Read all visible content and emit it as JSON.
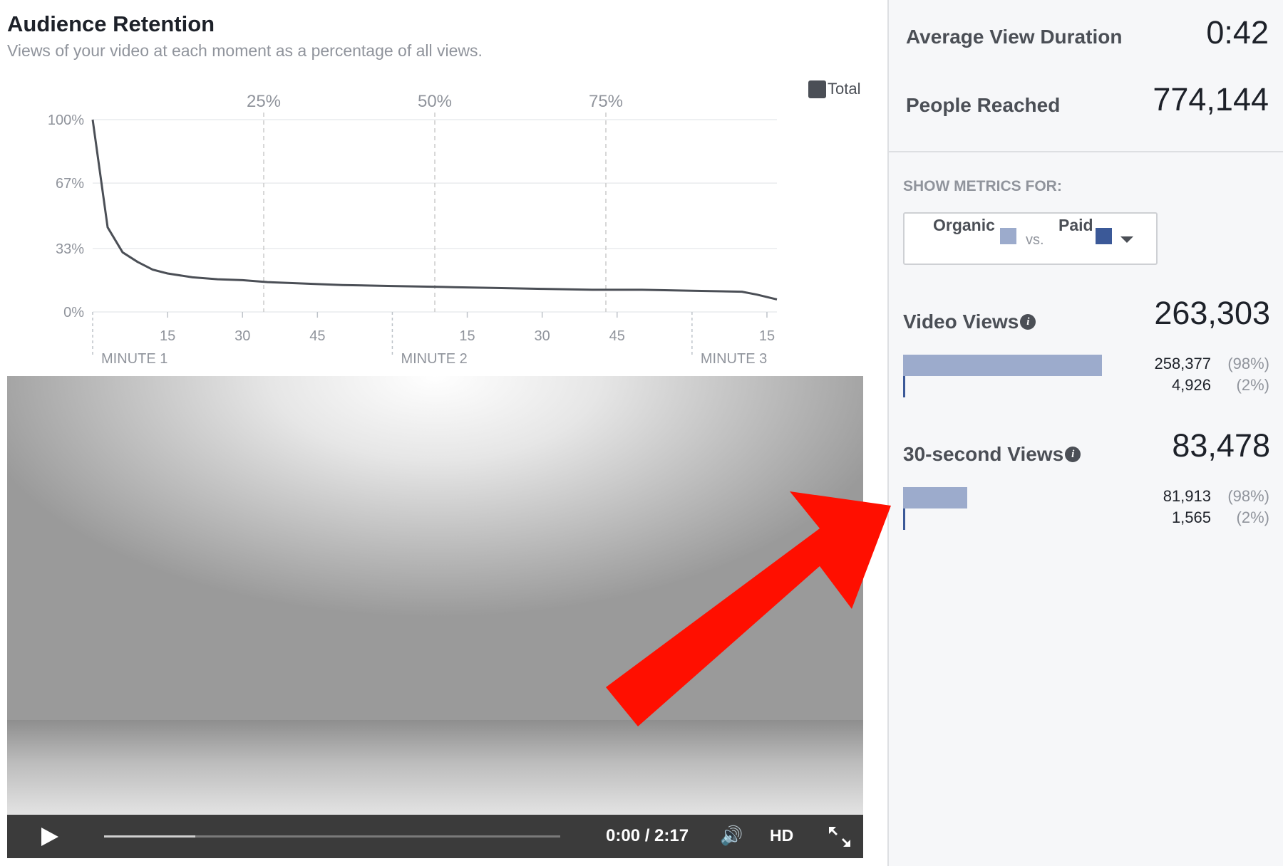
{
  "retention": {
    "title": "Audience Retention",
    "subtitle": "Views of your video at each moment as a percentage of all views.",
    "legend": "Total",
    "quartiles": [
      "25%",
      "50%",
      "75%"
    ],
    "y_ticks": [
      "100%",
      "67%",
      "33%",
      "0%"
    ],
    "x_ticks": [
      "15",
      "30",
      "45",
      "15",
      "30",
      "45",
      "15"
    ],
    "minute_labels": [
      "MINUTE 1",
      "MINUTE 2",
      "MINUTE 3"
    ]
  },
  "chart_data": {
    "type": "line",
    "title": "Audience Retention",
    "xlabel": "",
    "ylabel": "",
    "ylim": [
      0,
      100
    ],
    "xlim": [
      0,
      137
    ],
    "grid": true,
    "legend_position": "top-right",
    "series": [
      {
        "name": "Total",
        "color": "#4b4f56",
        "x": [
          0,
          3,
          6,
          9,
          12,
          15,
          20,
          25,
          30,
          35,
          40,
          45,
          50,
          60,
          70,
          80,
          90,
          100,
          110,
          120,
          130,
          133,
          137
        ],
        "y": [
          100,
          44,
          31,
          26,
          22,
          20,
          18,
          17,
          16.5,
          15.5,
          15,
          14.5,
          14,
          13.5,
          13,
          12.5,
          12,
          11.5,
          11.5,
          11,
          10.5,
          9,
          6.5
        ]
      }
    ],
    "quartile_markers": [
      "25%",
      "50%",
      "75%"
    ]
  },
  "video": {
    "time": "0:00 / 2:17",
    "hd_label": "HD",
    "progress": 0.2
  },
  "summary": {
    "avg_view_duration_label": "Average View Duration",
    "avg_view_duration_value": "0:42",
    "people_reached_label": "People Reached",
    "people_reached_value": "774,144"
  },
  "metrics": {
    "heading": "SHOW METRICS FOR:",
    "organic_label": "Organic",
    "vs_label": "vs.",
    "paid_label": "Paid",
    "video_views": {
      "label": "Video Views",
      "total": "263,303",
      "organic": "258,377",
      "organic_pct": "(98%)",
      "organic_share": 0.98,
      "paid": "4,926",
      "paid_pct": "(2%)"
    },
    "thirty_second_views": {
      "label": "30-second Views",
      "total": "83,478",
      "organic": "81,913",
      "organic_pct": "(98%)",
      "organic_share": 0.317,
      "paid": "1,565",
      "paid_pct": "(2%)"
    }
  },
  "colors": {
    "organic": "#9cabcc",
    "paid": "#3b5998",
    "line": "#4b4f56",
    "annotation_arrow": "#ff0f00"
  }
}
